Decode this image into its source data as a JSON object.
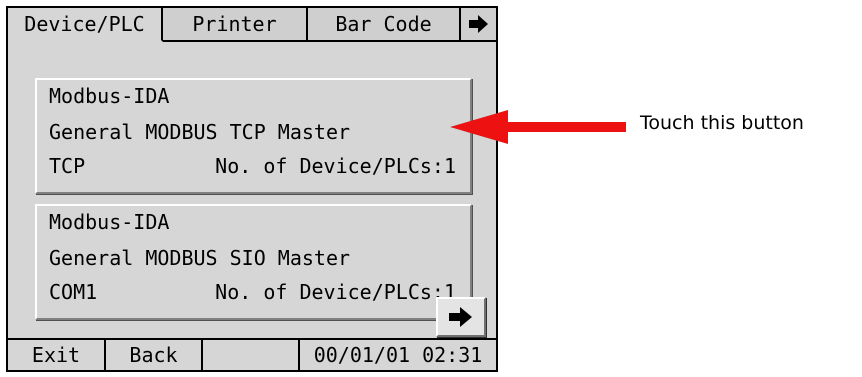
{
  "tabs": [
    {
      "label": "Device/PLC",
      "active": true
    },
    {
      "label": "Printer",
      "active": false
    },
    {
      "label": "Bar Code",
      "active": false
    },
    {
      "icon": "arrow-right-icon"
    }
  ],
  "entries": [
    {
      "protocol": "Modbus-IDA",
      "description": "General MODBUS TCP Master",
      "port": "TCP",
      "count_label": "No. of Device/PLCs:1"
    },
    {
      "protocol": "Modbus-IDA",
      "description": "General MODBUS SIO Master",
      "port": "COM1",
      "count_label": "No. of Device/PLCs:1"
    }
  ],
  "next_button": {
    "icon": "arrow-right-icon"
  },
  "statusbar": {
    "exit_label": "Exit",
    "back_label": "Back",
    "datetime": "00/01/01 02:31"
  },
  "annotation": {
    "text": "Touch this button",
    "arrow_color": "#ee1111"
  },
  "colors": {
    "panel_bg": "#d6d6d6",
    "border": "#000000"
  }
}
